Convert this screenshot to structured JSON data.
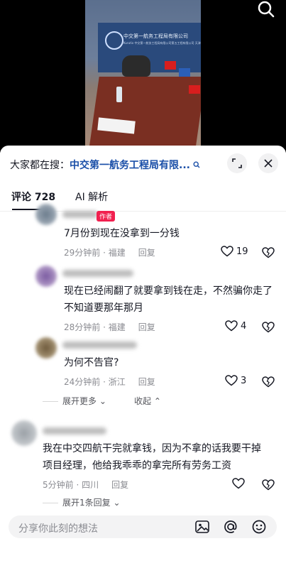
{
  "video": {
    "banner_text": "中交第一航务工程局有限公司",
    "banner_sub": "Kurutix 中交第一航务工程局有限公司第五工程有限公司 天津"
  },
  "panel": {
    "hot_search_prefix": "大家都在搜：",
    "hot_search_link": "中交第一航务工程局有限...",
    "tabs": {
      "comments": "评论 728",
      "ai": "AI 解析"
    }
  },
  "comments": [
    {
      "badge": "作者",
      "text": "7月份到现在没拿到一分钱",
      "time": "29分钟前 · 福建",
      "reply": "回复",
      "likes": "19"
    },
    {
      "text": "现在已经闹翻了就要拿到钱在走，不然骗你走了不知道要那年那月",
      "time": "28分钟前 · 福建",
      "reply": "回复",
      "likes": "4"
    },
    {
      "text": "为何不告官?",
      "time": "24分钟前 · 浙江",
      "reply": "回复",
      "likes": "3"
    },
    {
      "text": "我在中交四航干完就拿钱，因为不拿的话我要干掉项目经理，他给我乖乖的拿完所有劳务工资",
      "time": "5分钟前 · 四川",
      "reply": "回复",
      "likes": ""
    }
  ],
  "threads": {
    "expand_more": "展开更多",
    "collapse": "收起",
    "expand_one": "展开1条回复"
  },
  "input": {
    "placeholder": "分享你此刻的想法"
  },
  "colors": {
    "link": "#1a4fa8",
    "author_badge": "#f1204f",
    "meta": "#8a8b91"
  }
}
